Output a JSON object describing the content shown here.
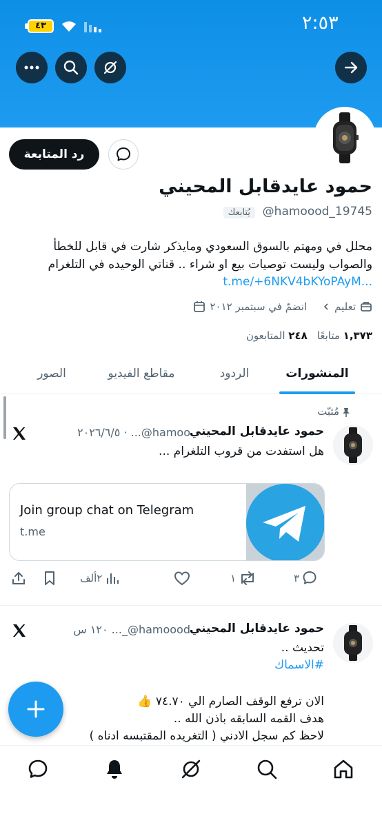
{
  "status_bar": {
    "time": "٢:٥٣",
    "battery": "٤٣"
  },
  "profile": {
    "display_name": "حمود عايدقابل المحيني",
    "handle": "@hamoood_19745",
    "follows_you": "يُتابعك",
    "follow_back_label": "رد المتابعة",
    "bio": "محلل في ومهتم بالسوق السعودي ومايذكر شارت في قابل للخطأ والصواب وليست توصيات بيع او شراء .. قناتي الوحيده في التلغرام",
    "bio_link": "t.me/+6NKV4bKYoPAyM...",
    "category": "تعليم",
    "joined": "انضمّ في سبتمبر ٢٠١٢",
    "following_count": "٢٤٨",
    "following_label": "متابعًا",
    "followers_count": "١,٣٧٣",
    "followers_label": "المتابعون"
  },
  "tabs": [
    {
      "label": "المنشورات",
      "active": true
    },
    {
      "label": "الردود",
      "active": false
    },
    {
      "label": "مقاطع الفيديو",
      "active": false
    },
    {
      "label": "الصور",
      "active": false
    }
  ],
  "posts": [
    {
      "pinned_label": "مُثبّت",
      "name": "حمود عايدقابل المحيني",
      "handle_time": "‎@hamoo... ‏· ٢٠٢٦/٦/٥",
      "text": "هل استفدت من قروب التلغرام ...",
      "card": {
        "title": "Join group chat on Telegram",
        "domain": "t.me"
      },
      "stats": {
        "replies": "٣",
        "reposts": "١",
        "likes": "",
        "views": "٢ألف"
      }
    },
    {
      "name": "حمود عايدقابل المحيني",
      "handle_time": "‎@hamoood_...‏ ١٢٠ س",
      "lines": [
        "تحديث ..",
        "#الاسماك",
        "",
        "الان ترفع الوقف الصارم الي ٧٤.٧٠ 👍",
        "هدف القمه السابقه باذن الله ..",
        "لاحظ كم سجل الادني ( التغريده المقتبسه ادناه )"
      ]
    }
  ],
  "colors": {
    "accent": "#1d9bf0",
    "text": "#0f1419",
    "secondary": "#536471"
  }
}
